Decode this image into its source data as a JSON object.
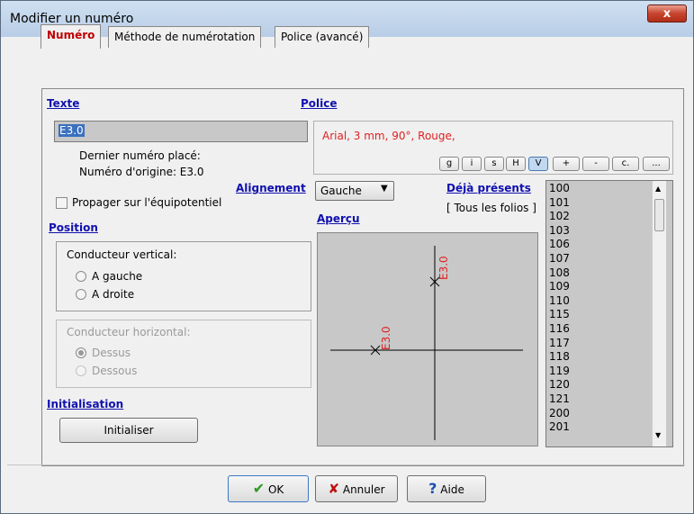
{
  "window": {
    "title": "Modifier un numéro",
    "close_label": "x"
  },
  "tabs": [
    {
      "label": "Numéro"
    },
    {
      "label": "Méthode de numérotation"
    },
    {
      "label": "Police (avancé)"
    }
  ],
  "texte": {
    "heading": "Texte",
    "value": "E3.0",
    "last_placed": "Dernier numéro placé:",
    "origin": "Numéro d'origine: E3.0",
    "propagate_label": "Propager sur l'équipotentiel"
  },
  "police": {
    "heading": "Police",
    "summary": "Arial, 3 mm, 90°, Rouge,"
  },
  "font_buttons": [
    "g",
    "i",
    "s",
    "H",
    "V",
    "+",
    "-",
    "c.",
    "..."
  ],
  "alignement": {
    "label": "Alignement",
    "value": "Gauche"
  },
  "deja": {
    "heading": "Déjà présents",
    "filter": "[ Tous les folios ]",
    "items": [
      "100",
      "101",
      "102",
      "103",
      "106",
      "107",
      "108",
      "109",
      "110",
      "115",
      "116",
      "117",
      "118",
      "119",
      "120",
      "121",
      "200",
      "201"
    ]
  },
  "apercu": {
    "heading": "Aperçu",
    "label_vertical": "E3.0",
    "label_horizontal": "E3.0"
  },
  "position": {
    "heading": "Position",
    "vertical": {
      "label": "Conducteur vertical:",
      "options": [
        "A gauche",
        "A droite"
      ]
    },
    "horizontal": {
      "label": "Conducteur horizontal:",
      "options": [
        "Dessus",
        "Dessous"
      ]
    }
  },
  "initialisation": {
    "heading": "Initialisation",
    "button": "Initialiser"
  },
  "footer": {
    "ok": "OK",
    "cancel": "Annuler",
    "help": "Aide"
  },
  "colors": {
    "accent_red": "#e02020",
    "section_blue": "#1010b0",
    "ok_green": "#2a9a20"
  }
}
